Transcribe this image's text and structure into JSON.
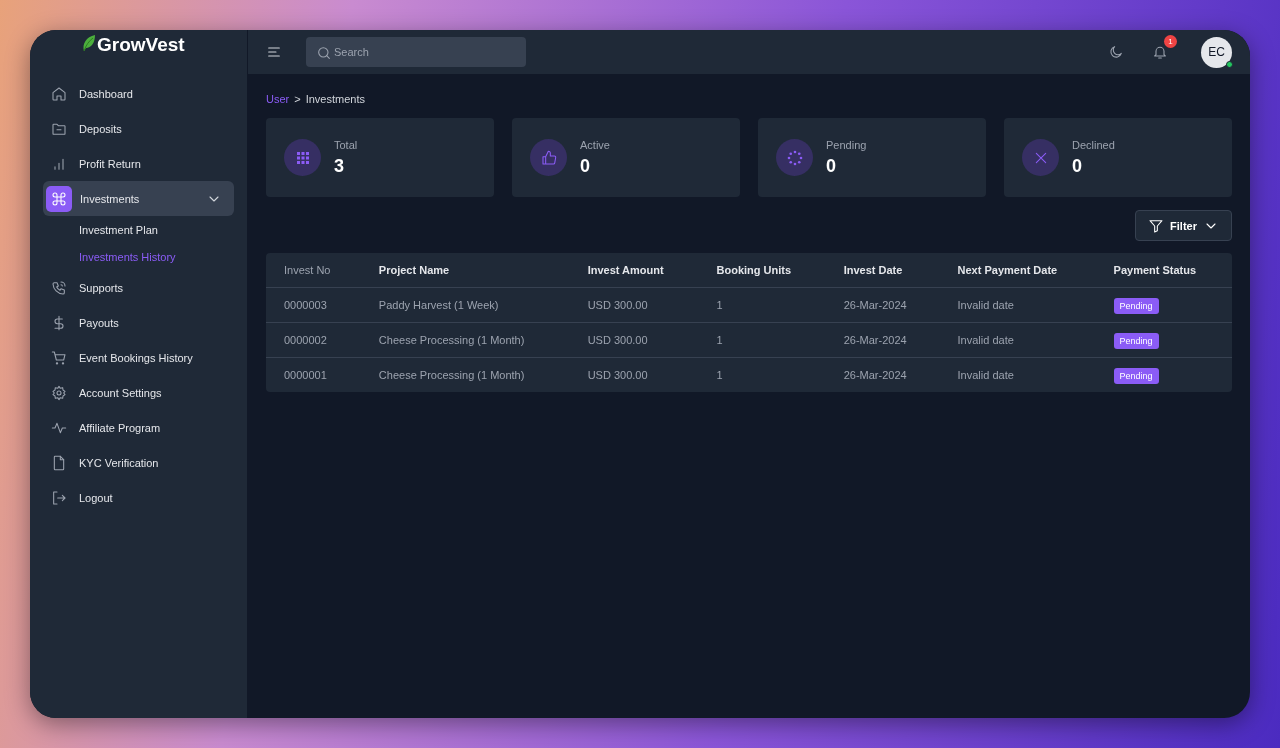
{
  "brand": {
    "name": "GrowVest"
  },
  "header": {
    "search": {
      "placeholder": "Search"
    },
    "notifications": {
      "count": "1"
    },
    "avatar": {
      "initials": "EC",
      "online": true
    }
  },
  "sidebar": {
    "items": [
      {
        "label": "Dashboard",
        "selected": false
      },
      {
        "label": "Deposits",
        "selected": false
      },
      {
        "label": "Profit Return",
        "selected": false
      },
      {
        "label": "Investments",
        "selected": true,
        "expanded": true,
        "children": [
          {
            "label": "Investment Plan",
            "selected": false
          },
          {
            "label": "Investments History",
            "selected": true
          }
        ]
      },
      {
        "label": "Supports",
        "selected": false
      },
      {
        "label": "Payouts",
        "selected": false
      },
      {
        "label": "Event Bookings History",
        "selected": false
      },
      {
        "label": "Account Settings",
        "selected": false
      },
      {
        "label": "Affiliate Program",
        "selected": false
      },
      {
        "label": "KYC Verification",
        "selected": false
      },
      {
        "label": "Logout",
        "selected": false
      }
    ]
  },
  "breadcrumb": {
    "items": [
      "User",
      "Investments"
    ],
    "separator": ">"
  },
  "stats": [
    {
      "label": "Total",
      "value": "3"
    },
    {
      "label": "Active",
      "value": "0"
    },
    {
      "label": "Pending",
      "value": "0"
    },
    {
      "label": "Declined",
      "value": "0"
    }
  ],
  "filter_button": {
    "label": "Filter"
  },
  "table": {
    "columns": [
      "Invest No",
      "Project Name",
      "Invest Amount",
      "Booking Units",
      "Invest Date",
      "Next Payment Date",
      "Payment Status"
    ],
    "rows": [
      [
        "0000003",
        "Paddy Harvest (1 Week)",
        "USD 300.00",
        "1",
        "26-Mar-2024",
        "Invalid date",
        "Pending"
      ],
      [
        "0000002",
        "Cheese Processing (1 Month)",
        "USD 300.00",
        "1",
        "26-Mar-2024",
        "Invalid date",
        "Pending"
      ],
      [
        "0000001",
        "Cheese Processing (1 Month)",
        "USD 300.00",
        "1",
        "26-Mar-2024",
        "Invalid date",
        "Pending"
      ]
    ]
  }
}
